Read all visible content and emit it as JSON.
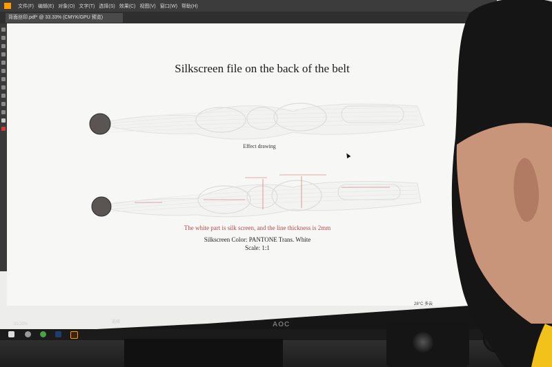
{
  "app": {
    "menu": [
      "文件(F)",
      "编辑(E)",
      "对象(O)",
      "文字(T)",
      "选择(S)",
      "效果(C)",
      "视图(V)",
      "窗口(W)",
      "帮助(H)"
    ],
    "doc_tab": "背面丝印.pdf* @ 33.33% (CMYK/GPU 预览)",
    "zoom": "33.33%",
    "status_text": "选择"
  },
  "artboard": {
    "title": "Silkscreen file on the back of the belt",
    "caption": "Effect drawing",
    "note": "The white part is silk screen, and the line thickness is 2mm",
    "color_line": "Silkscreen Color: PANTONE Trans. White",
    "scale_line": "Scale: 1:1"
  },
  "taskbar": {
    "tray_text": "28°C 多云",
    "monitor_brand": "AOC"
  },
  "colors": {
    "artboard_bg": "#f7f7f5",
    "note_red": "#b44a4a",
    "circle_fill": "#5a5552",
    "ui_dark": "#3c3c3c"
  }
}
